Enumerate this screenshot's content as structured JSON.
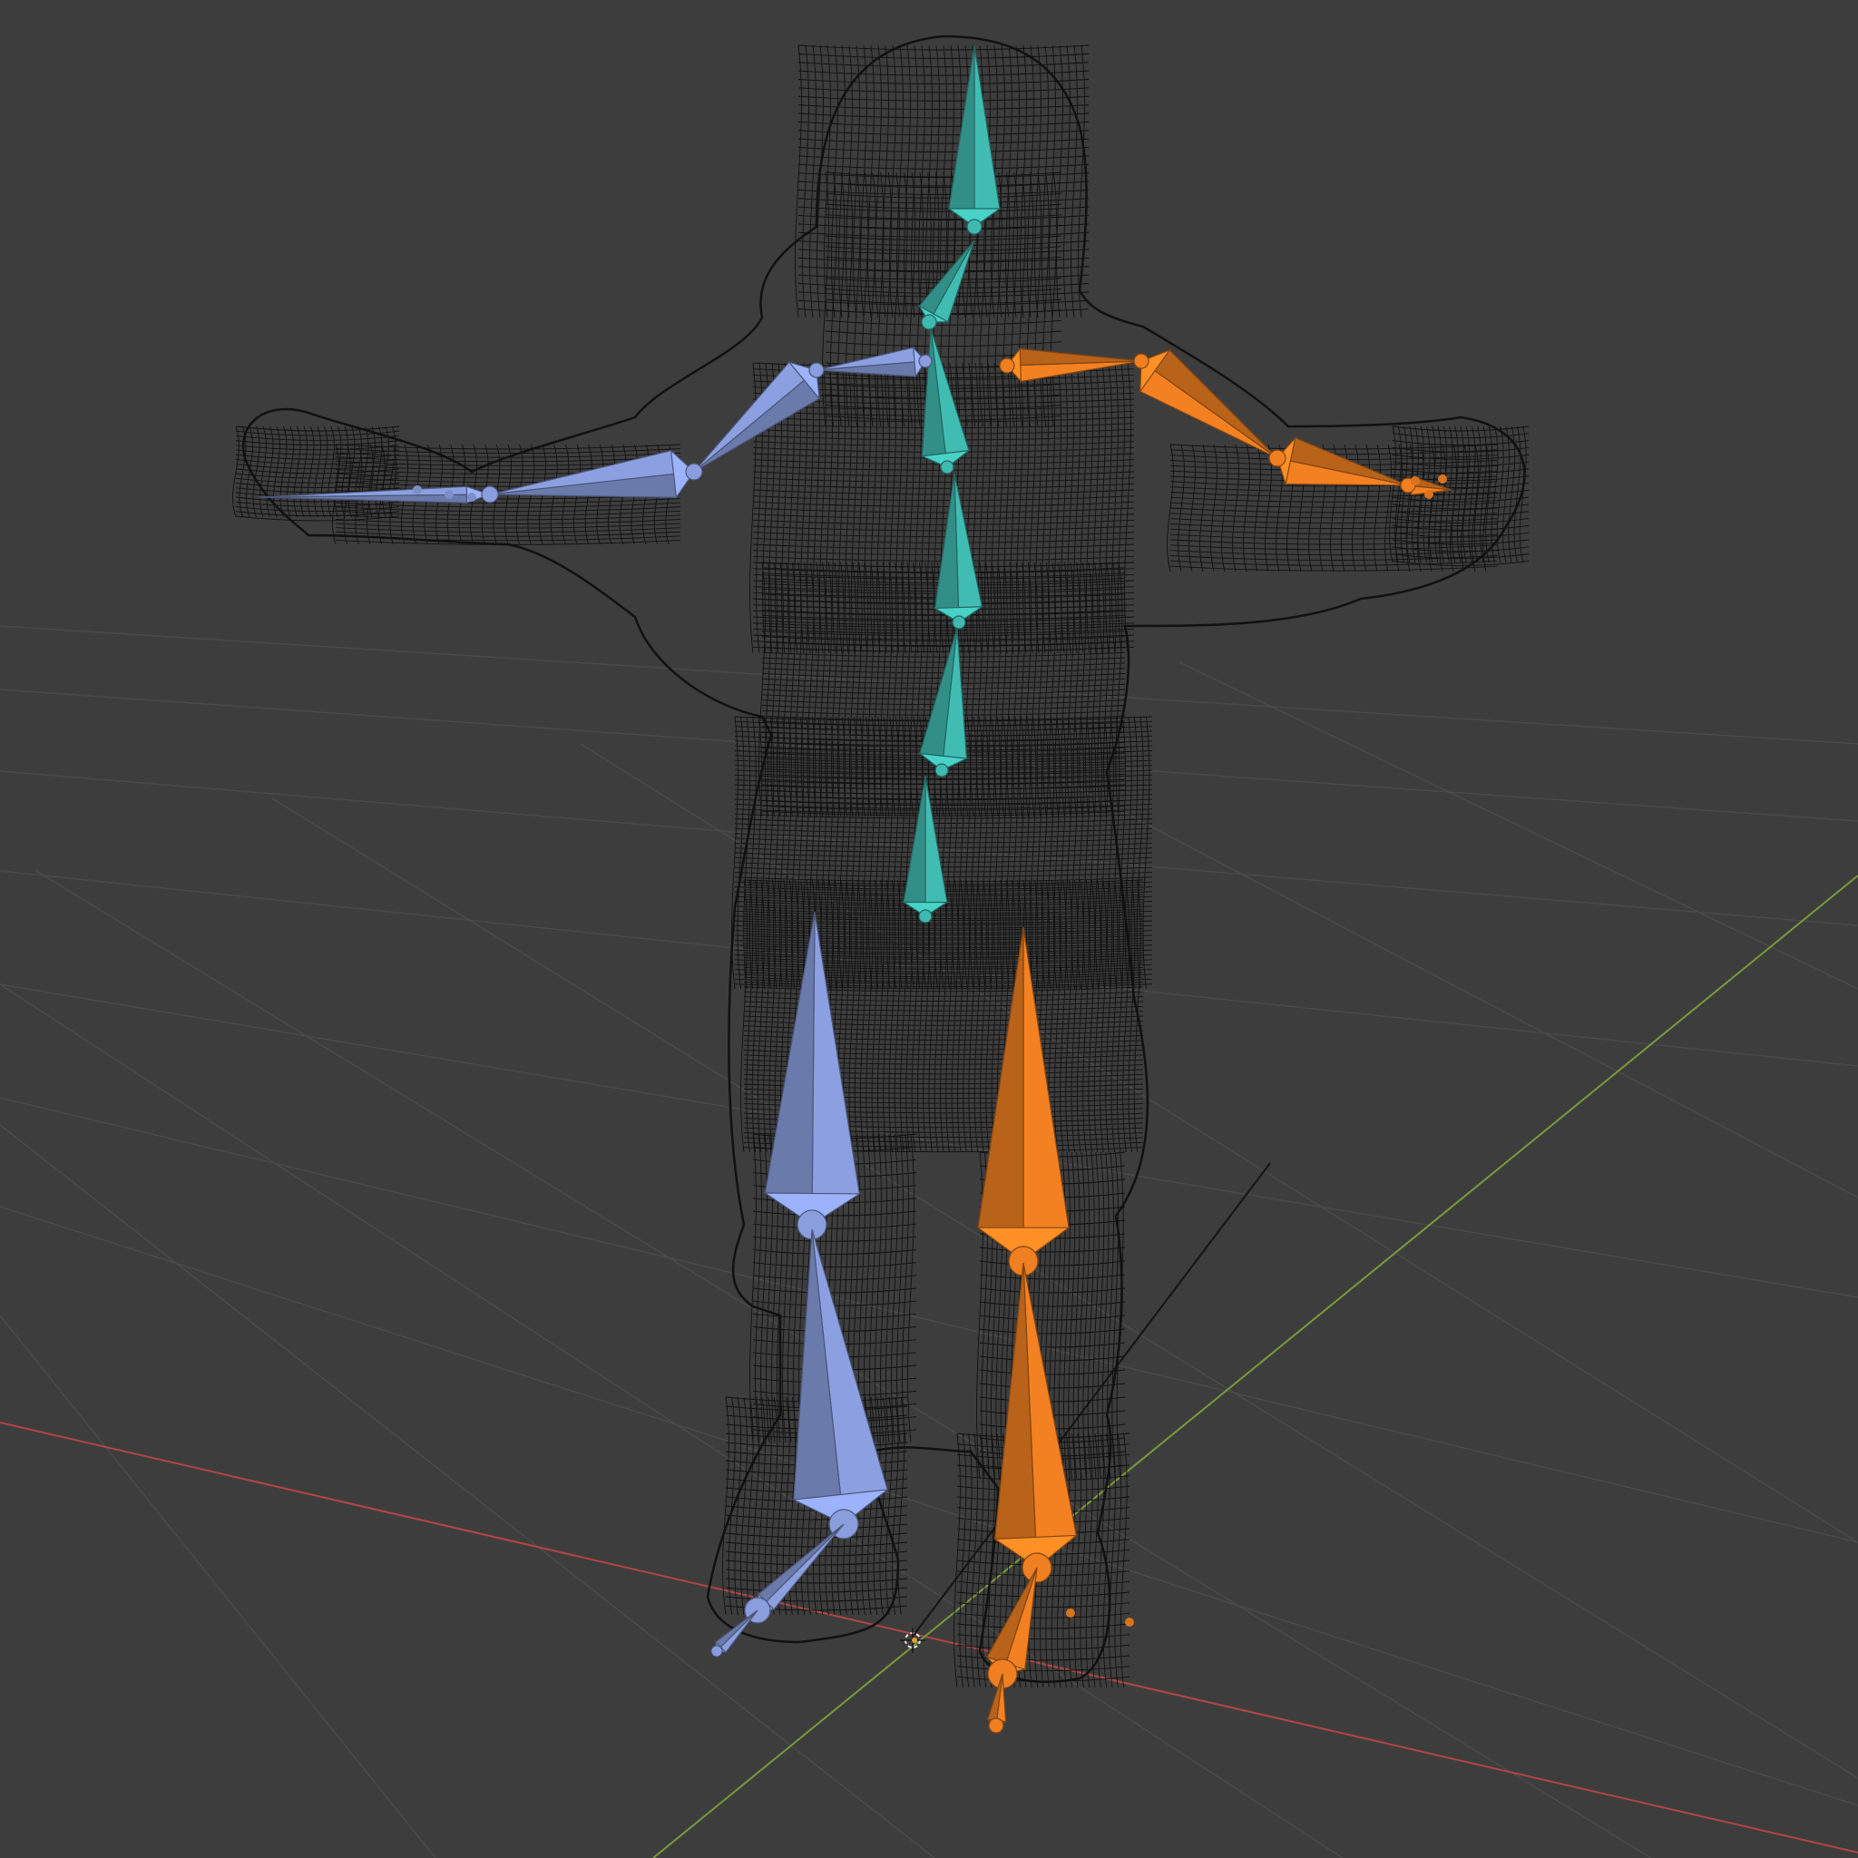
{
  "viewport": {
    "background": "#3d3d3d",
    "grid_color": "#4a4a4a",
    "x_axis_color": "#b34545",
    "y_axis_color": "#7a9a3a",
    "mesh_color": "#111111",
    "mesh_display": "wireframe"
  },
  "armature": {
    "colors": {
      "center": "#3aa8a0",
      "left": "#7d8fc9",
      "right": "#d9731e"
    },
    "chains": [
      {
        "group": "center",
        "bones": [
          "head",
          "neck",
          "spine_upper",
          "spine_mid",
          "spine_lower",
          "hips"
        ]
      },
      {
        "group": "left",
        "bones": [
          "shoulder",
          "upper_arm",
          "forearm",
          "hand",
          "thigh",
          "shin",
          "foot",
          "toe"
        ]
      },
      {
        "group": "right",
        "bones": [
          "shoulder",
          "upper_arm",
          "forearm",
          "hand",
          "thigh",
          "shin",
          "foot",
          "toe"
        ]
      }
    ]
  }
}
